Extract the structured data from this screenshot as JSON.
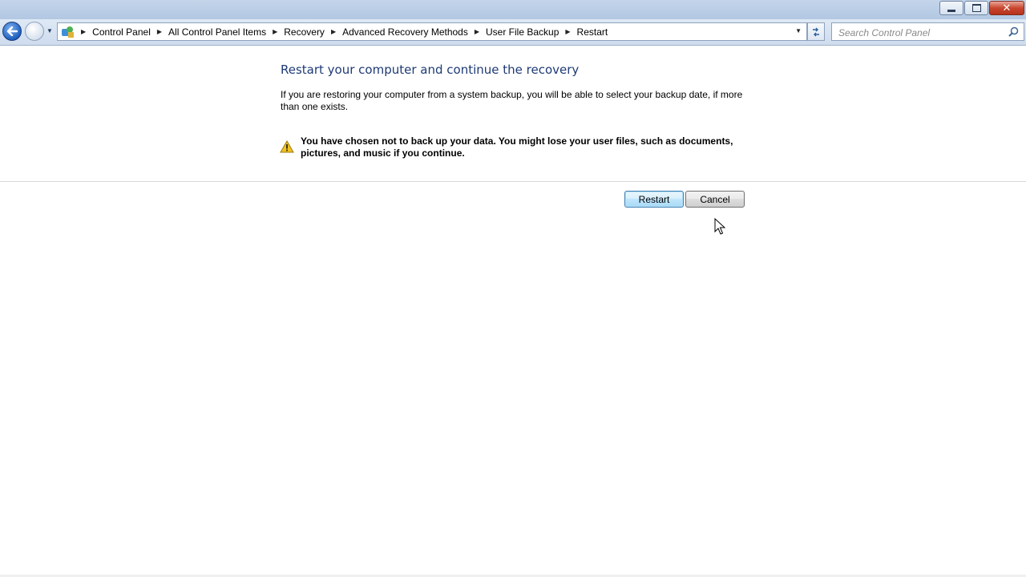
{
  "window": {
    "caption_buttons": {
      "minimize": "minimize",
      "maximize": "restore",
      "close": "✕"
    }
  },
  "nav": {
    "back_glyph": "🡐",
    "breadcrumbs": [
      {
        "label": "Control Panel"
      },
      {
        "label": "All Control Panel Items"
      },
      {
        "label": "Recovery"
      },
      {
        "label": "Advanced Recovery Methods"
      },
      {
        "label": "User File Backup"
      },
      {
        "label": "Restart"
      }
    ],
    "search_placeholder": "Search Control Panel"
  },
  "main": {
    "title": "Restart your computer and continue the recovery",
    "description": "If you are restoring your computer from a system backup, you will be able to select your backup date, if more than one exists.",
    "warning": "You have chosen not to back up your data. You might lose your user files, such as documents, pictures, and music if you continue.",
    "restart_label": "Restart",
    "cancel_label": "Cancel"
  },
  "icons": {
    "back": "back-arrow-icon",
    "forward": "forward-arrow-icon",
    "control_panel": "control-panel-icon",
    "refresh": "refresh-icon",
    "search": "search-icon",
    "warning": "warning-icon"
  },
  "colors": {
    "title_blue": "#1e3a75",
    "close_red": "#c8462f",
    "warning_yellow": "#f2c320"
  }
}
